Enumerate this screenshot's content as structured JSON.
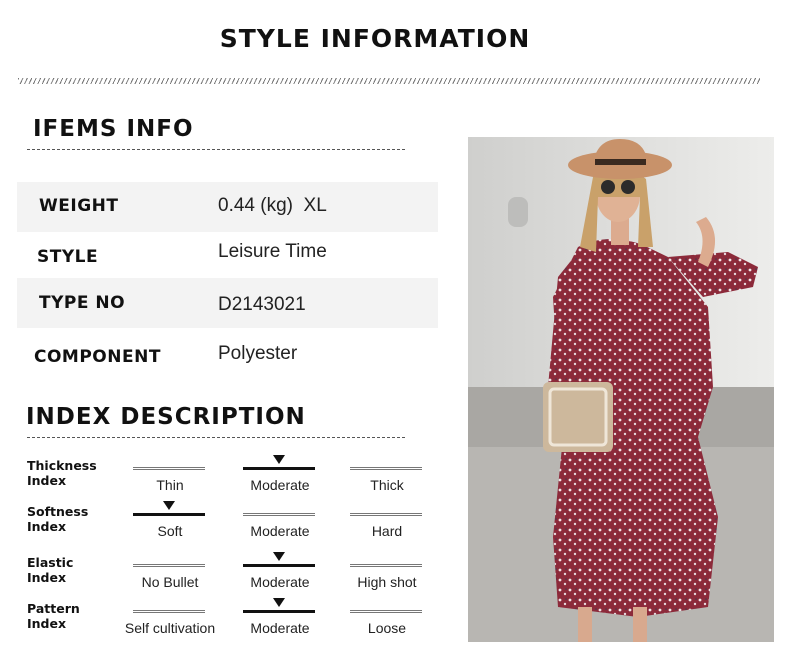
{
  "header": {
    "title": "STYLE INFORMATION"
  },
  "items_info": {
    "heading": "IFEMS INFO",
    "rows": [
      {
        "label": "WEIGHT",
        "value": "0.44 (kg)  XL"
      },
      {
        "label": "STYLE",
        "value": "Leisure Time"
      },
      {
        "label": "TYPE NO",
        "value": "D2143021"
      },
      {
        "label": "COMPONENT",
        "value": "Polyester"
      }
    ]
  },
  "index_description": {
    "heading": "INDEX DESCRIPTION",
    "indices": [
      {
        "label_line1": "Thickness",
        "label_line2": "Index",
        "options": [
          "Thin",
          "Moderate",
          "Thick"
        ],
        "selected_index": 1
      },
      {
        "label_line1": "Softness",
        "label_line2": "Index",
        "options": [
          "Soft",
          "Moderate",
          "Hard"
        ],
        "selected_index": 0
      },
      {
        "label_line1": "Elastic",
        "label_line2": "Index",
        "options": [
          "No Bullet",
          "Moderate",
          "High shot"
        ],
        "selected_index": 1
      },
      {
        "label_line1": "Pattern",
        "label_line2": "Index",
        "options": [
          "Self cultivation",
          "Moderate",
          "Loose"
        ],
        "selected_index": 1
      }
    ]
  },
  "colors": {
    "dress": "#8c2a3a",
    "hat": "#c8926a",
    "wall": "#e6e6e4",
    "ground": "#b8b6b2"
  }
}
